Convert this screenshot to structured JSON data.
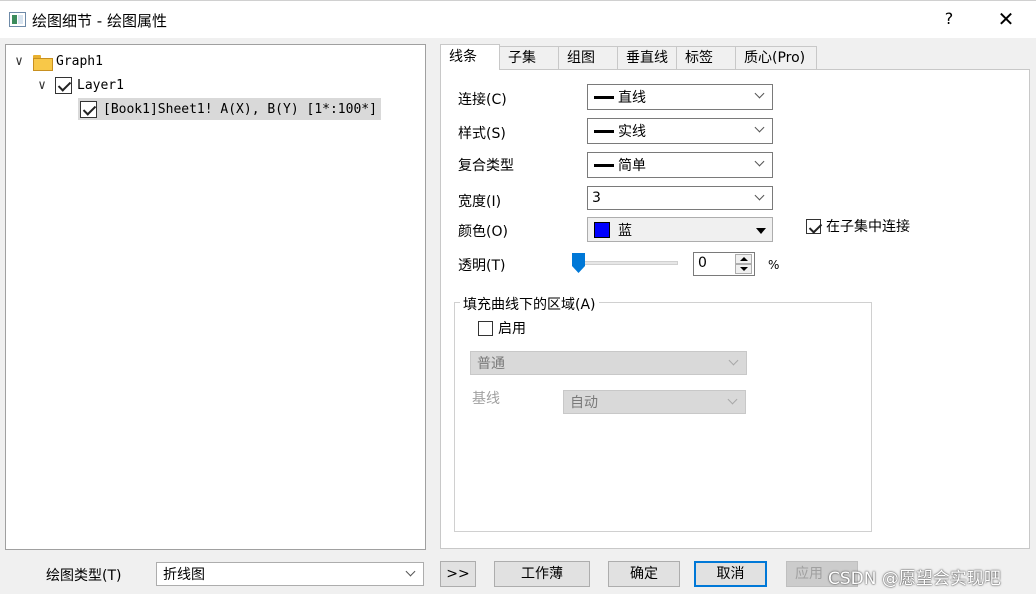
{
  "window": {
    "title": "绘图细节 - 绘图属性",
    "help": "?",
    "close": "✕"
  },
  "tree": {
    "graph": "Graph1",
    "layer": "Layer1",
    "plot": "[Book1]Sheet1! A(X), B(Y) [1*:100*]"
  },
  "tabs": [
    "线条",
    "子集",
    "组图",
    "垂直线",
    "标签",
    "质心(Pro)"
  ],
  "line": {
    "connect_label": "连接(C)",
    "connect_value": "直线",
    "style_label": "样式(S)",
    "style_value": "实线",
    "composite_label": "复合类型",
    "composite_value": "简单",
    "width_label": "宽度(I)",
    "width_value": "3",
    "color_label": "颜色(O)",
    "color_value": "蓝",
    "color_hex": "#0000ff",
    "connect_subset_label": "在子集中连接",
    "connect_subset_checked": true,
    "transparency_label": "透明(T)",
    "transparency_value": "0",
    "transparency_unit": "%"
  },
  "fill": {
    "group_title": "填充曲线下的区域(A)",
    "enable_label": "启用",
    "enable_checked": false,
    "mode_value": "普通",
    "baseline_label": "基线",
    "baseline_value": "自动"
  },
  "footer": {
    "plot_type_label": "绘图类型(T)",
    "plot_type_value": "折线图",
    "expand": ">>",
    "workbook": "工作薄",
    "ok": "确定",
    "cancel": "取消",
    "apply": "应用",
    "watermark": "CSDN @愿望会实现吧"
  }
}
